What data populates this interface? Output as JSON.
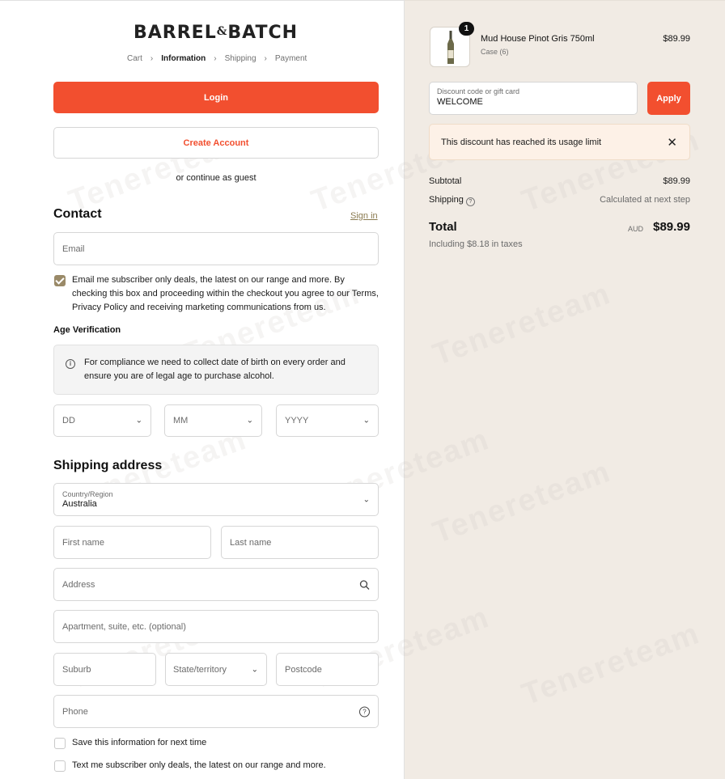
{
  "brand": {
    "name_left": "BARREL",
    "amp": "&",
    "name_right": "BATCH"
  },
  "breadcrumb": {
    "cart": "Cart",
    "information": "Information",
    "shipping": "Shipping",
    "payment": "Payment",
    "separator": "›"
  },
  "auth": {
    "login_label": "Login",
    "create_account_label": "Create Account",
    "guest_text": "or continue as guest"
  },
  "contact": {
    "heading": "Contact",
    "sign_in": "Sign in",
    "email_placeholder": "Email",
    "subscribe_text": "Email me subscriber only deals, the latest on our range and more. By checking this box and proceeding within the checkout you agree to our Terms, Privacy Policy and receiving marketing communications from us.",
    "subscribe_checked": true
  },
  "age": {
    "heading": "Age Verification",
    "notice": "For compliance we need to collect date of birth on every order and ensure you are of legal age to purchase alcohol.",
    "day": "DD",
    "month": "MM",
    "year": "YYYY"
  },
  "shipping": {
    "heading": "Shipping address",
    "country_label": "Country/Region",
    "country_value": "Australia",
    "first_name": "First name",
    "last_name": "Last name",
    "address": "Address",
    "apartment": "Apartment, suite, etc. (optional)",
    "suburb": "Suburb",
    "state": "State/territory",
    "postcode": "Postcode",
    "phone": "Phone",
    "save_info": "Save this information for next time",
    "text_me": "Text me subscriber only deals, the latest on our range and more."
  },
  "order": {
    "item": {
      "name": "Mud House Pinot Gris 750ml",
      "variant": "Case (6)",
      "price": "$89.99",
      "quantity": "1"
    },
    "discount_label": "Discount code or gift card",
    "discount_value": "WELCOME",
    "apply_label": "Apply",
    "alert": "This discount has reached its usage limit",
    "subtotal_label": "Subtotal",
    "subtotal_value": "$89.99",
    "shipping_label": "Shipping",
    "shipping_value": "Calculated at next step",
    "total_label": "Total",
    "currency": "AUD",
    "total_value": "$89.99",
    "taxes": "Including $8.18 in taxes"
  },
  "colors": {
    "accent": "#f24f2f",
    "checkbox": "#9a8a68",
    "summary_bg": "#f1ebe4"
  },
  "watermark": "Tenereteam"
}
